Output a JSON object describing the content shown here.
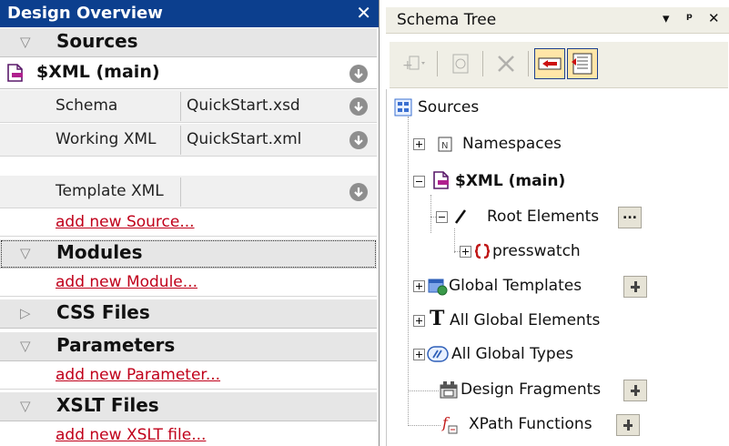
{
  "design_overview": {
    "title": "Design Overview",
    "close_glyph": "✕",
    "sections": {
      "sources": {
        "label": "Sources"
      },
      "modules": {
        "label": "Modules"
      },
      "css": {
        "label": "CSS Files"
      },
      "parameters": {
        "label": "Parameters"
      },
      "xslt": {
        "label": "XSLT Files"
      }
    },
    "main_source": {
      "label": "$XML (main)",
      "rows": [
        {
          "key": "Schema",
          "value": "QuickStart.xsd"
        },
        {
          "key": "Working XML",
          "value": "QuickStart.xml"
        },
        {
          "key": "Template XML",
          "value": ""
        }
      ]
    },
    "links": {
      "add_source": "add new Source...",
      "add_module": "add new Module...",
      "add_parameter": "add new Parameter...",
      "add_xslt": "add new XSLT file..."
    }
  },
  "schema_tree": {
    "title": "Schema Tree",
    "controls": {
      "dropdown": "▾",
      "pin": "ᵖ",
      "close": "✕"
    },
    "items": {
      "sources": "Sources",
      "namespaces": "Namespaces",
      "xml_main": "$XML (main)",
      "root_elements": "Root Elements",
      "presswatch": "presswatch",
      "global_templates": "Global Templates",
      "all_global_elements": "All Global Elements",
      "all_global_types": "All Global Types",
      "design_fragments": "Design Fragments",
      "xpath_functions": "XPath Functions"
    },
    "colors": {
      "tree_lines": "#a0a0a0",
      "accent": "#0c3f8e",
      "link": "#c0001a"
    }
  }
}
